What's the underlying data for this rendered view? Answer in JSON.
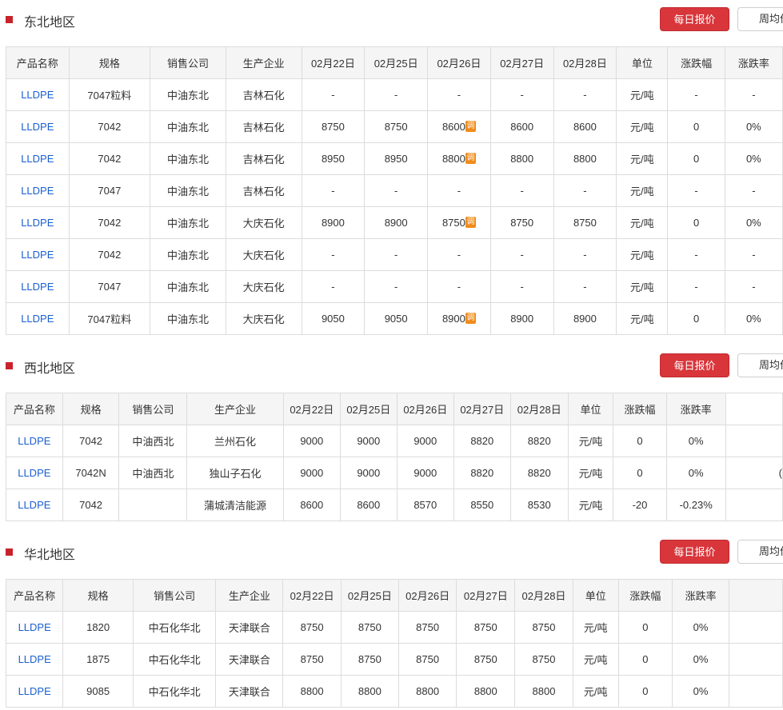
{
  "sections": [
    {
      "title": "东北地区",
      "btn_daily": "每日报价",
      "btn_weekly": "周均价",
      "headers": [
        "产品名称",
        "规格",
        "销售公司",
        "生产企业",
        "02月22日",
        "02月25日",
        "02月26日",
        "02月27日",
        "02月28日",
        "单位",
        "涨跌幅",
        "涨跌率"
      ],
      "rows": [
        [
          "LLDPE",
          "7047粒料",
          "中油东北",
          "吉林石化",
          "-",
          "-",
          "-",
          "-",
          "-",
          "元/吨",
          "-",
          "-"
        ],
        [
          "LLDPE",
          "7042",
          "中油东北",
          "吉林石化",
          "8750",
          "8750",
          "8600",
          "8600",
          "8600",
          "元/吨",
          "0",
          "0%"
        ],
        [
          "LLDPE",
          "7042",
          "中油东北",
          "吉林石化",
          "8950",
          "8950",
          "8800",
          "8800",
          "8800",
          "元/吨",
          "0",
          "0%"
        ],
        [
          "LLDPE",
          "7047",
          "中油东北",
          "吉林石化",
          "-",
          "-",
          "-",
          "-",
          "-",
          "元/吨",
          "-",
          "-"
        ],
        [
          "LLDPE",
          "7042",
          "中油东北",
          "大庆石化",
          "8900",
          "8900",
          "8750",
          "8750",
          "8750",
          "元/吨",
          "0",
          "0%"
        ],
        [
          "LLDPE",
          "7042",
          "中油东北",
          "大庆石化",
          "-",
          "-",
          "-",
          "-",
          "-",
          "元/吨",
          "-",
          "-"
        ],
        [
          "LLDPE",
          "7047",
          "中油东北",
          "大庆石化",
          "-",
          "-",
          "-",
          "-",
          "-",
          "元/吨",
          "-",
          "-"
        ],
        [
          "LLDPE",
          "7047粒料",
          "中油东北",
          "大庆石化",
          "9050",
          "9050",
          "8900",
          "8900",
          "8900",
          "元/吨",
          "0",
          "0%"
        ]
      ],
      "adjust_badge": "调"
    },
    {
      "title": "西北地区",
      "btn_daily": "每日报价",
      "btn_weekly": "周均价",
      "headers": [
        "产品名称",
        "规格",
        "销售公司",
        "生产企业",
        "02月22日",
        "02月25日",
        "02月26日",
        "02月27日",
        "02月28日",
        "单位",
        "涨跌幅",
        "涨跌率"
      ],
      "rows": [
        [
          "LLDPE",
          "7042",
          "中油西北",
          "兰州石化",
          "9000",
          "9000",
          "9000",
          "8820",
          "8820",
          "元/吨",
          "0",
          "0%"
        ],
        [
          "LLDPE",
          "7042N",
          "中油西北",
          "独山子石化",
          "9000",
          "9000",
          "9000",
          "8820",
          "8820",
          "元/吨",
          "0",
          "0%"
        ],
        [
          "LLDPE",
          "7042",
          "",
          "蒲城清洁能源",
          "8600",
          "8600",
          "8570",
          "8550",
          "8530",
          "元/吨",
          "-20",
          "-0.23%"
        ]
      ],
      "extra_col_text": [
        "",
        "(",
        " "
      ]
    },
    {
      "title": "华北地区",
      "btn_daily": "每日报价",
      "btn_weekly": "周均价",
      "headers": [
        "产品名称",
        "规格",
        "销售公司",
        "生产企业",
        "02月22日",
        "02月25日",
        "02月26日",
        "02月27日",
        "02月28日",
        "单位",
        "涨跌幅",
        "涨跌率"
      ],
      "rows": [
        [
          "LLDPE",
          "1820",
          "中石化华北",
          "天津联合",
          "8750",
          "8750",
          "8750",
          "8750",
          "8750",
          "元/吨",
          "0",
          "0%"
        ],
        [
          "LLDPE",
          "1875",
          "中石化华北",
          "天津联合",
          "8750",
          "8750",
          "8750",
          "8750",
          "8750",
          "元/吨",
          "0",
          "0%"
        ],
        [
          "LLDPE",
          "9085",
          "中石化华北",
          "天津联合",
          "8800",
          "8800",
          "8800",
          "8800",
          "8800",
          "元/吨",
          "0",
          "0%"
        ]
      ]
    }
  ],
  "colors": {
    "accent_red": "#d8363b",
    "link_blue": "#1a5fcf",
    "down_green": "#3aa83a",
    "badge_orange": "#f08c1a"
  }
}
